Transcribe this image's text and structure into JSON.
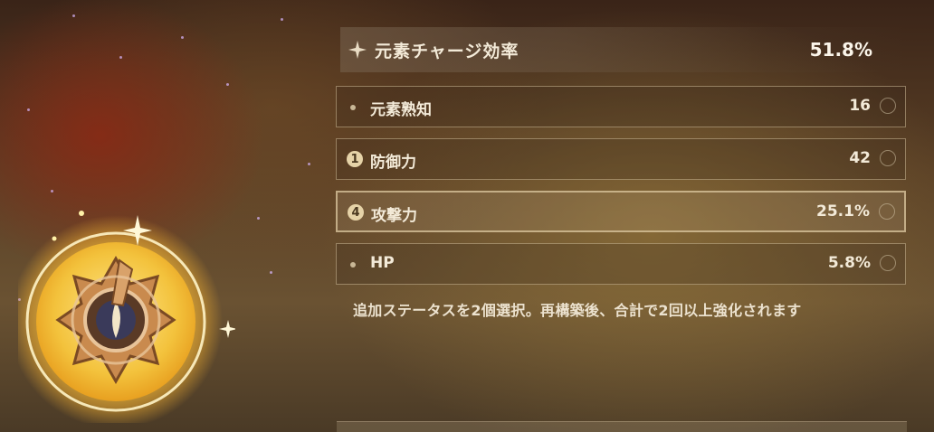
{
  "main_stat": {
    "name": "元素チャージ効率",
    "value": "51.8%",
    "icon": "sparkle-icon"
  },
  "sub_stats": [
    {
      "name": "元素熟知",
      "value": "16",
      "marker": "",
      "selected": false
    },
    {
      "name": "防御力",
      "value": "42",
      "marker": "1",
      "selected": false
    },
    {
      "name": "攻撃力",
      "value": "25.1%",
      "marker": "4",
      "selected": true
    },
    {
      "name": "HP",
      "value": "5.8%",
      "marker": "",
      "selected": false
    }
  ],
  "hint": "追加ステータスを2個選択。再構築後、合計で2回以上強化されます",
  "artifact": {
    "icon": "artifact-flower-icon"
  },
  "colors": {
    "text": "#f3ead8",
    "badge": "#e6d3a8",
    "border": "#cdb996"
  }
}
